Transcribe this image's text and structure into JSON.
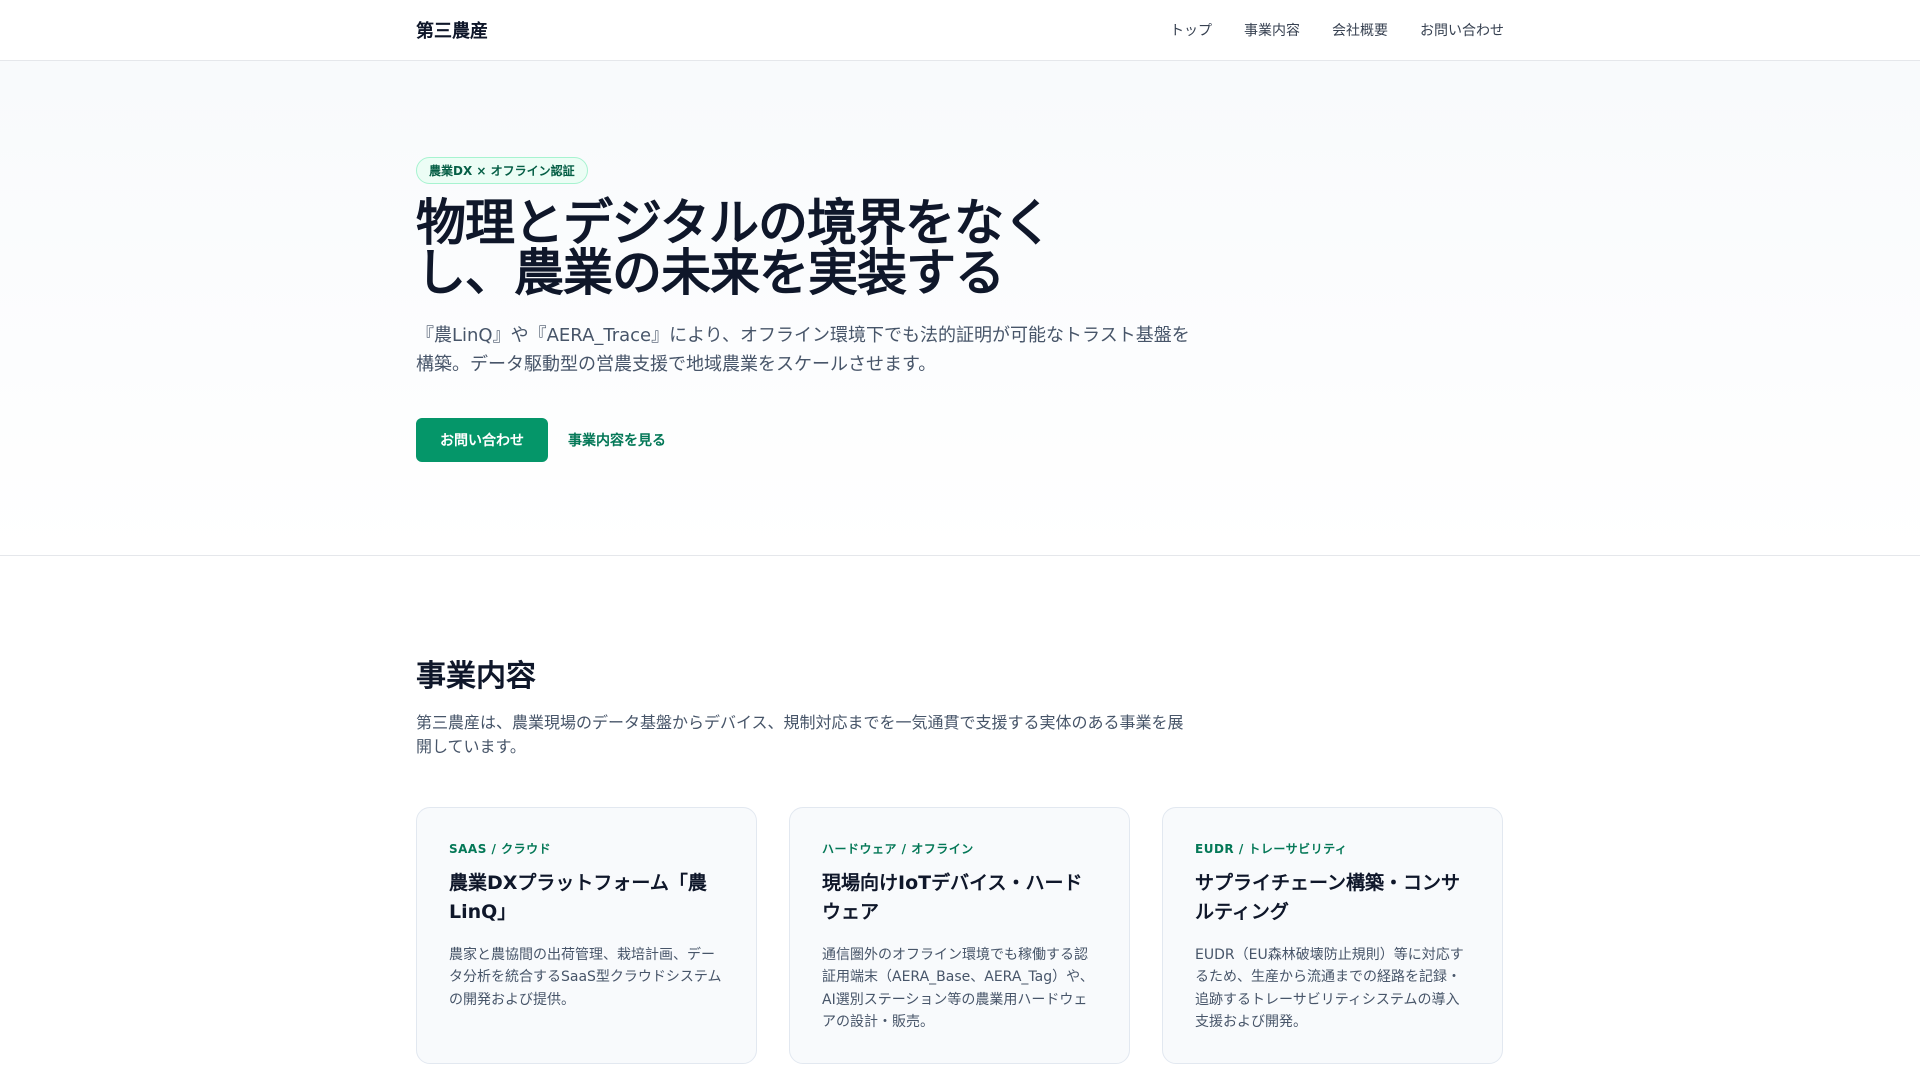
{
  "header": {
    "brand": "第三農産",
    "nav": [
      "トップ",
      "事業内容",
      "会社概要",
      "お問い合わせ"
    ]
  },
  "hero": {
    "badge": "農業DX × オフライン認証",
    "title": "物理とデジタルの境界をなくし、農業の未来を実装する",
    "lead": "『農LinQ』や『AERA_Trace』により、オフライン環境下でも法的証明が可能なトラスト基盤を構築。データ駆動型の営農支援で地域農業をスケールさせます。",
    "primary_button": "お問い合わせ",
    "secondary_link": "事業内容を見る"
  },
  "services": {
    "title": "事業内容",
    "description": "第三農産は、農業現場のデータ基盤からデバイス、規制対応までを一気通貫で支援する実体のある事業を展開しています。",
    "cards": [
      {
        "tag": "SAAS / クラウド",
        "title": "農業DXプラットフォーム「農LinQ」",
        "text": "農家と農協間の出荷管理、栽培計画、データ分析を統合するSaaS型クラウドシステムの開発および提供。"
      },
      {
        "tag": "ハードウェア / オフライン",
        "title": "現場向けIoTデバイス・ハードウェア",
        "text": "通信圏外のオフライン環境でも稼働する認証用端末（AERA_Base、AERA_Tag）や、AI選別ステーション等の農業用ハードウェアの設計・販売。"
      },
      {
        "tag": "EUDR / トレーサビリティ",
        "title": "サプライチェーン構築・コンサルティング",
        "text": "EUDR（EU森林破壊防止規則）等に対応するため、生産から流通までの経路を記録・追跡するトレーサビリティシステムの導入支援および開発。"
      }
    ]
  }
}
